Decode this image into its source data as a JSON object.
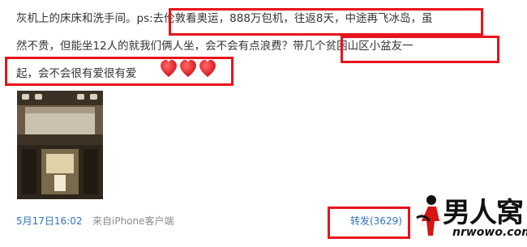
{
  "post": {
    "line1_a": "灰机上的床床和洗手间。p",
    "line1_b": "s:去伦敦看奥运，888万包机，往返8天，中途再飞冰岛，虽",
    "line2_a": "然不贵，但能坐12人的就我们俩人坐，会不会有点浪费？",
    "line2_b": "带几个贫困山区小盆友一",
    "line3": "起，会不会很有爱很有爱"
  },
  "meta": {
    "time": "5月17日16:02",
    "source": "来自iPhone客户端",
    "repost": "转发(3629)"
  },
  "watermark": {
    "text_cn": "男人窝",
    "url": "nrwowo.com"
  },
  "colors": {
    "highlight": "#e8141b",
    "link": "#2f73b8",
    "heart": "#e5141b"
  }
}
